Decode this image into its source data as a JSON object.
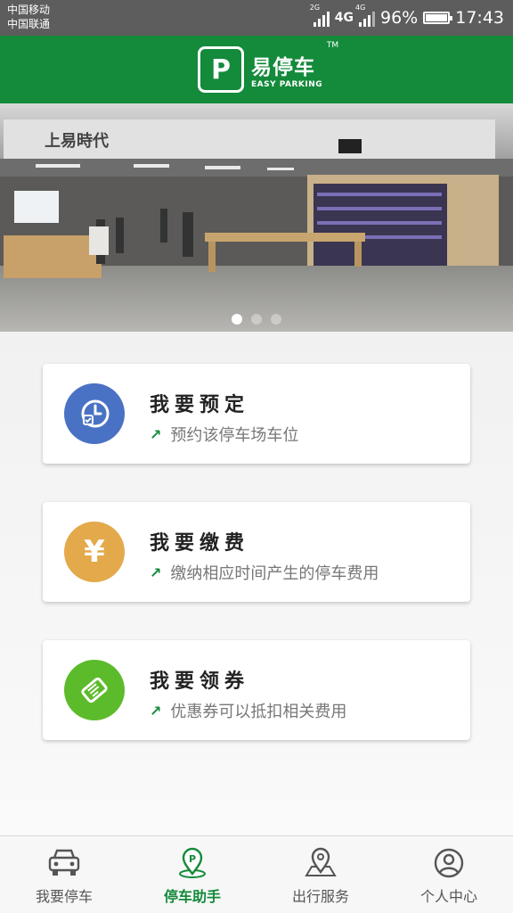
{
  "status_bar": {
    "carrier_1": "中国移动",
    "carrier_2": "中国联通",
    "signal_1_tag": "2G",
    "network": "4G",
    "signal_2_tag": "4G",
    "battery": "96%",
    "time": "17:43"
  },
  "app_bar": {
    "logo_mark": "P",
    "logo_cn": "易停车",
    "logo_en": "EASY PARKING",
    "logo_tm": "TM"
  },
  "banner": {
    "store_sign": "上易時代",
    "page_count": 3,
    "active_page": 0
  },
  "cards": [
    {
      "title": "我要预定",
      "subtitle": "预约该停车场车位",
      "icon": "clock-icon",
      "color": "#4a72c4"
    },
    {
      "title": "我要缴费",
      "subtitle": "缴纳相应时间产生的停车费用",
      "icon": "yen-icon",
      "color": "#e3a94b"
    },
    {
      "title": "我要领券",
      "subtitle": "优惠券可以抵扣相关费用",
      "icon": "coupon-icon",
      "color": "#5cbb2a"
    }
  ],
  "tabs": [
    {
      "label": "我要停车",
      "icon": "car-icon",
      "active": false
    },
    {
      "label": "停车助手",
      "icon": "parking-pin-icon",
      "active": true
    },
    {
      "label": "出行服务",
      "icon": "map-pin-icon",
      "active": false
    },
    {
      "label": "个人中心",
      "icon": "user-icon",
      "active": false
    }
  ],
  "colors": {
    "brand": "#148a3b",
    "status_bar": "#5d5d5d"
  }
}
